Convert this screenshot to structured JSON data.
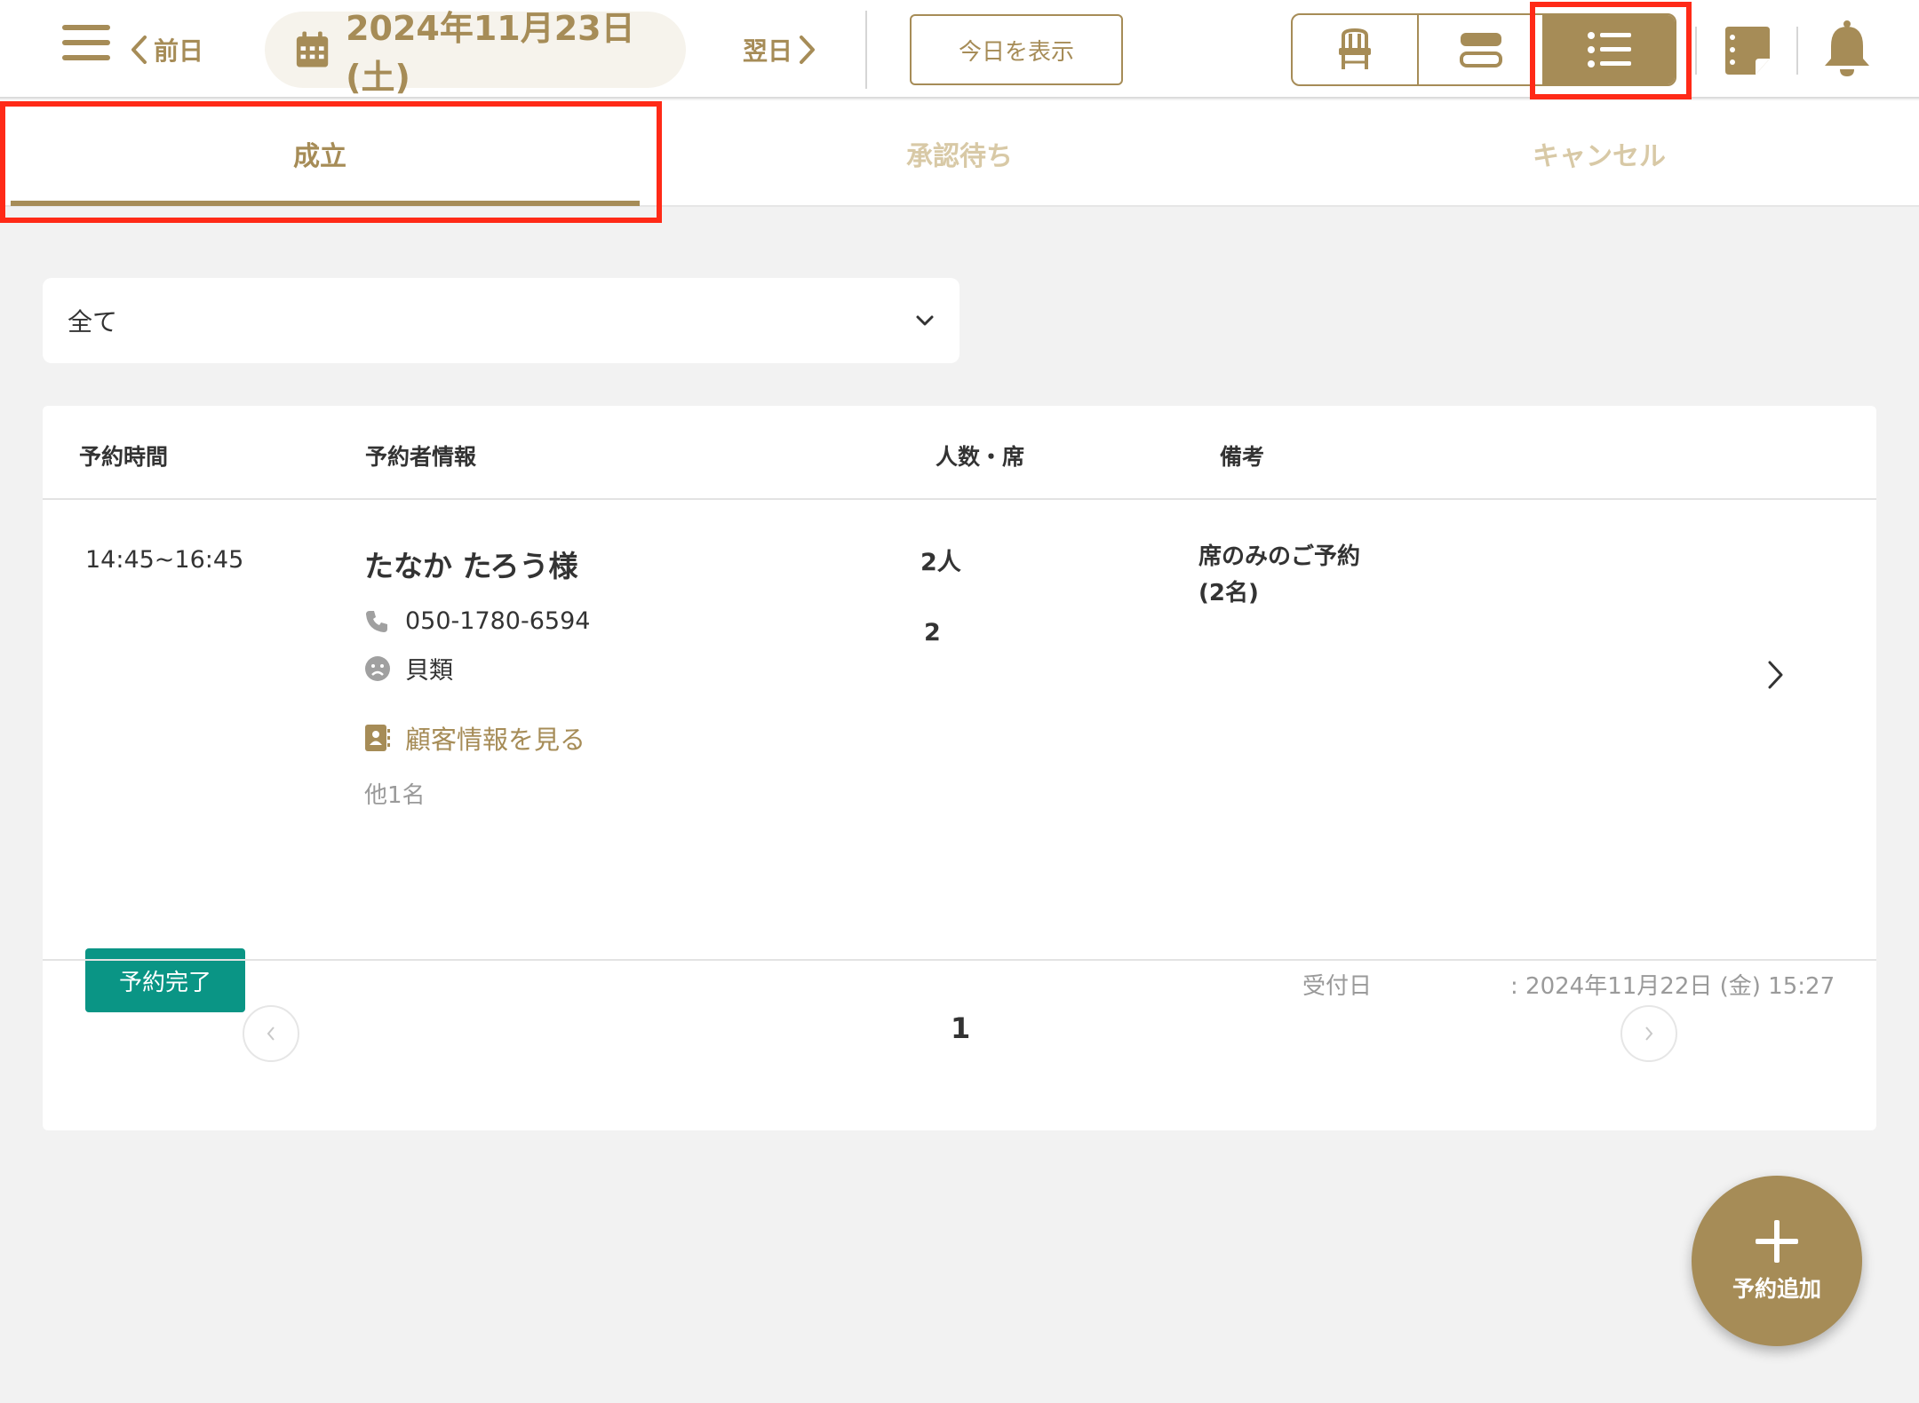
{
  "header": {
    "prev_label": "前日",
    "next_label": "翌日",
    "date_label": "2024年11月23日 (土)",
    "today_label": "今日を表示"
  },
  "tabs": [
    {
      "label": "成立",
      "active": true
    },
    {
      "label": "承認待ち",
      "active": false
    },
    {
      "label": "キャンセル",
      "active": false
    }
  ],
  "filter": {
    "selected": "全て"
  },
  "table": {
    "headers": [
      "予約時間",
      "予約者情報",
      "人数・席",
      "備考"
    ],
    "rows": [
      {
        "time": "14:45~16:45",
        "name": "たなか たろう様",
        "phone": "050-1780-6594",
        "allergy": "貝類",
        "customer_link": "顧客情報を見る",
        "others": "他1名",
        "people": "2人",
        "seat": "2",
        "note_line1": "席のみのご予約",
        "note_line2": "(2名)",
        "status": "予約完了",
        "received_label": "受付日",
        "received_value": ": 2024年11月22日 (金) 15:27"
      }
    ]
  },
  "pagination": {
    "current": "1"
  },
  "fab": {
    "label": "予約追加"
  },
  "colors": {
    "accent": "#a68c57",
    "status_done": "#0a9585",
    "highlight": "#ff2a17"
  }
}
